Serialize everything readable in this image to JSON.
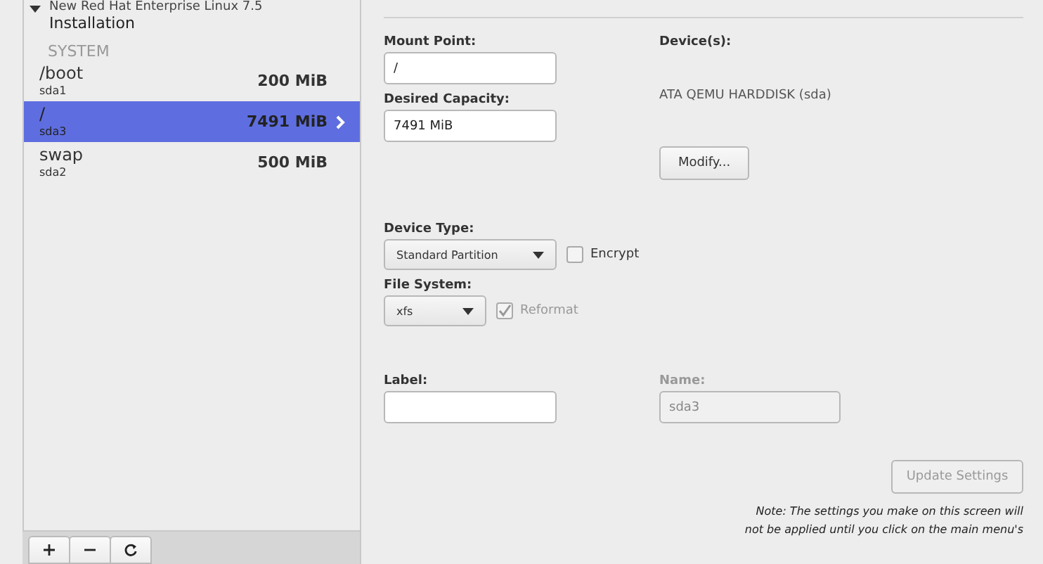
{
  "sidebar": {
    "group_title": "New Red Hat Enterprise Linux 7.5",
    "group_subtitle": "Installation",
    "expanded": true,
    "section": "SYSTEM",
    "items": [
      {
        "mount": "/boot",
        "device": "sda1",
        "size": "200 MiB",
        "selected": false
      },
      {
        "mount": "/",
        "device": "sda3",
        "size": "7491 MiB",
        "selected": true
      },
      {
        "mount": "swap",
        "device": "sda2",
        "size": "500 MiB",
        "selected": false
      }
    ],
    "toolbar": [
      {
        "kind": "add"
      },
      {
        "kind": "remove"
      },
      {
        "kind": "refresh"
      }
    ]
  },
  "details": {
    "mount_point": {
      "label": "Mount Point:",
      "value": "/"
    },
    "desired_capacity": {
      "label": "Desired Capacity:",
      "value": "7491 MiB"
    },
    "devices": {
      "label": "Device(s):",
      "value": "ATA QEMU HARDDISK (sda)"
    },
    "modify_button": "Modify...",
    "device_type": {
      "label": "Device Type:",
      "value": "Standard Partition"
    },
    "encrypt": {
      "label": "Encrypt",
      "checked": false
    },
    "file_system": {
      "label": "File System:",
      "value": "xfs"
    },
    "reformat": {
      "label": "Reformat",
      "checked": true,
      "disabled": true
    },
    "label_field": {
      "label": "Label:",
      "disabled": false
    },
    "name_field": {
      "label": "Name:",
      "value": "sda3",
      "disabled": true
    },
    "update_button": {
      "label": "Update Settings",
      "disabled": true
    },
    "note": "*Note:  The settings you make on this screen will not be applied until you click on the main menu's*"
  }
}
